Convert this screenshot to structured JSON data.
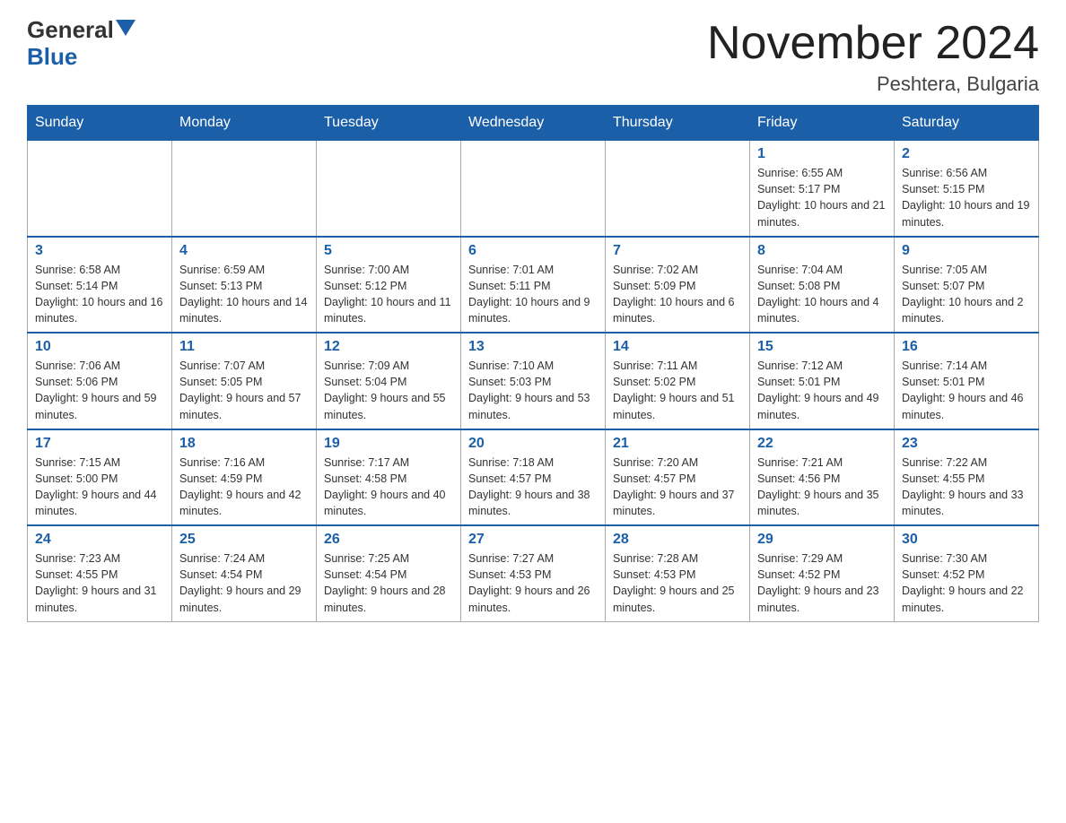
{
  "header": {
    "logo_general": "General",
    "logo_blue": "Blue",
    "month_title": "November 2024",
    "location": "Peshtera, Bulgaria"
  },
  "calendar": {
    "days_of_week": [
      "Sunday",
      "Monday",
      "Tuesday",
      "Wednesday",
      "Thursday",
      "Friday",
      "Saturday"
    ],
    "weeks": [
      [
        {
          "day": "",
          "info": ""
        },
        {
          "day": "",
          "info": ""
        },
        {
          "day": "",
          "info": ""
        },
        {
          "day": "",
          "info": ""
        },
        {
          "day": "",
          "info": ""
        },
        {
          "day": "1",
          "info": "Sunrise: 6:55 AM\nSunset: 5:17 PM\nDaylight: 10 hours and 21 minutes."
        },
        {
          "day": "2",
          "info": "Sunrise: 6:56 AM\nSunset: 5:15 PM\nDaylight: 10 hours and 19 minutes."
        }
      ],
      [
        {
          "day": "3",
          "info": "Sunrise: 6:58 AM\nSunset: 5:14 PM\nDaylight: 10 hours and 16 minutes."
        },
        {
          "day": "4",
          "info": "Sunrise: 6:59 AM\nSunset: 5:13 PM\nDaylight: 10 hours and 14 minutes."
        },
        {
          "day": "5",
          "info": "Sunrise: 7:00 AM\nSunset: 5:12 PM\nDaylight: 10 hours and 11 minutes."
        },
        {
          "day": "6",
          "info": "Sunrise: 7:01 AM\nSunset: 5:11 PM\nDaylight: 10 hours and 9 minutes."
        },
        {
          "day": "7",
          "info": "Sunrise: 7:02 AM\nSunset: 5:09 PM\nDaylight: 10 hours and 6 minutes."
        },
        {
          "day": "8",
          "info": "Sunrise: 7:04 AM\nSunset: 5:08 PM\nDaylight: 10 hours and 4 minutes."
        },
        {
          "day": "9",
          "info": "Sunrise: 7:05 AM\nSunset: 5:07 PM\nDaylight: 10 hours and 2 minutes."
        }
      ],
      [
        {
          "day": "10",
          "info": "Sunrise: 7:06 AM\nSunset: 5:06 PM\nDaylight: 9 hours and 59 minutes."
        },
        {
          "day": "11",
          "info": "Sunrise: 7:07 AM\nSunset: 5:05 PM\nDaylight: 9 hours and 57 minutes."
        },
        {
          "day": "12",
          "info": "Sunrise: 7:09 AM\nSunset: 5:04 PM\nDaylight: 9 hours and 55 minutes."
        },
        {
          "day": "13",
          "info": "Sunrise: 7:10 AM\nSunset: 5:03 PM\nDaylight: 9 hours and 53 minutes."
        },
        {
          "day": "14",
          "info": "Sunrise: 7:11 AM\nSunset: 5:02 PM\nDaylight: 9 hours and 51 minutes."
        },
        {
          "day": "15",
          "info": "Sunrise: 7:12 AM\nSunset: 5:01 PM\nDaylight: 9 hours and 49 minutes."
        },
        {
          "day": "16",
          "info": "Sunrise: 7:14 AM\nSunset: 5:01 PM\nDaylight: 9 hours and 46 minutes."
        }
      ],
      [
        {
          "day": "17",
          "info": "Sunrise: 7:15 AM\nSunset: 5:00 PM\nDaylight: 9 hours and 44 minutes."
        },
        {
          "day": "18",
          "info": "Sunrise: 7:16 AM\nSunset: 4:59 PM\nDaylight: 9 hours and 42 minutes."
        },
        {
          "day": "19",
          "info": "Sunrise: 7:17 AM\nSunset: 4:58 PM\nDaylight: 9 hours and 40 minutes."
        },
        {
          "day": "20",
          "info": "Sunrise: 7:18 AM\nSunset: 4:57 PM\nDaylight: 9 hours and 38 minutes."
        },
        {
          "day": "21",
          "info": "Sunrise: 7:20 AM\nSunset: 4:57 PM\nDaylight: 9 hours and 37 minutes."
        },
        {
          "day": "22",
          "info": "Sunrise: 7:21 AM\nSunset: 4:56 PM\nDaylight: 9 hours and 35 minutes."
        },
        {
          "day": "23",
          "info": "Sunrise: 7:22 AM\nSunset: 4:55 PM\nDaylight: 9 hours and 33 minutes."
        }
      ],
      [
        {
          "day": "24",
          "info": "Sunrise: 7:23 AM\nSunset: 4:55 PM\nDaylight: 9 hours and 31 minutes."
        },
        {
          "day": "25",
          "info": "Sunrise: 7:24 AM\nSunset: 4:54 PM\nDaylight: 9 hours and 29 minutes."
        },
        {
          "day": "26",
          "info": "Sunrise: 7:25 AM\nSunset: 4:54 PM\nDaylight: 9 hours and 28 minutes."
        },
        {
          "day": "27",
          "info": "Sunrise: 7:27 AM\nSunset: 4:53 PM\nDaylight: 9 hours and 26 minutes."
        },
        {
          "day": "28",
          "info": "Sunrise: 7:28 AM\nSunset: 4:53 PM\nDaylight: 9 hours and 25 minutes."
        },
        {
          "day": "29",
          "info": "Sunrise: 7:29 AM\nSunset: 4:52 PM\nDaylight: 9 hours and 23 minutes."
        },
        {
          "day": "30",
          "info": "Sunrise: 7:30 AM\nSunset: 4:52 PM\nDaylight: 9 hours and 22 minutes."
        }
      ]
    ]
  }
}
